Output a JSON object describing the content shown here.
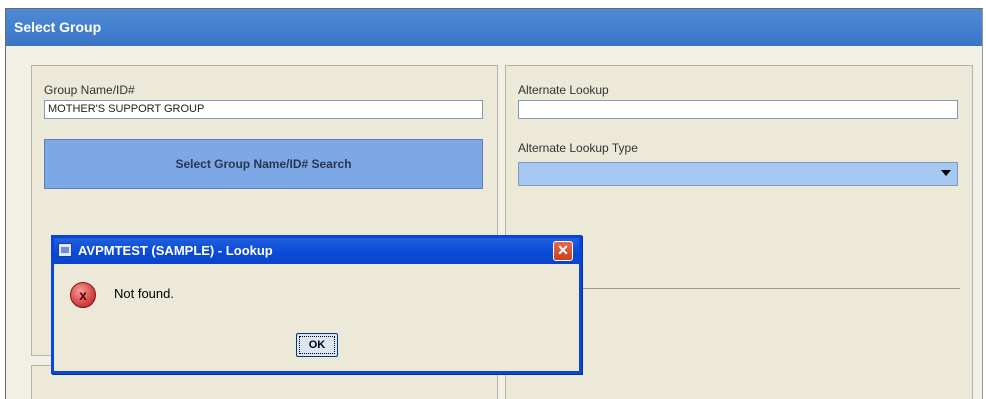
{
  "window": {
    "title": "Select Group"
  },
  "left_panel": {
    "group_label": "Group Name/ID#",
    "group_value": "MOTHER'S SUPPORT GROUP",
    "search_button": "Select Group Name/ID# Search"
  },
  "right_panel": {
    "alt_lookup_label": "Alternate Lookup",
    "alt_lookup_value": "",
    "alt_type_label": "Alternate Lookup Type",
    "alt_type_value": ""
  },
  "dialog": {
    "title": "AVPMTEST (SAMPLE) - Lookup",
    "message": "Not found.",
    "ok_label": "OK",
    "close_glyph": "✕",
    "error_glyph": "x"
  },
  "icons": {
    "app_icon": "app-icon",
    "close_icon": "close-icon",
    "error_icon": "error-icon",
    "dropdown_icon": "chevron-down-icon"
  },
  "colors": {
    "header_blue": "#3a76c5",
    "button_blue": "#7ea7e6",
    "dialog_blue": "#0a46d6",
    "close_red": "#c8421e"
  }
}
